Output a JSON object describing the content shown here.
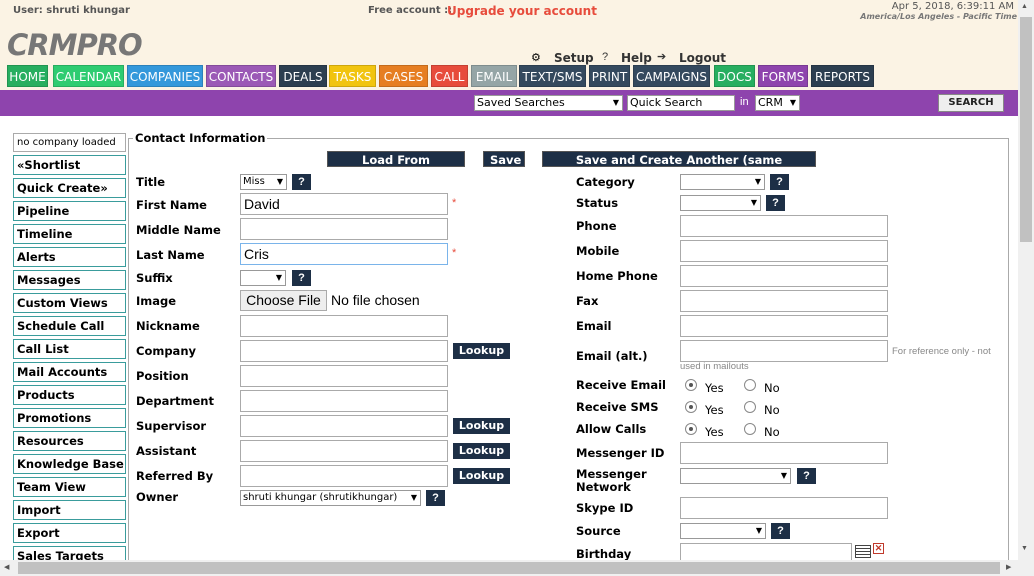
{
  "header": {
    "user_text": "User: shruti khungar",
    "free_account": "Free account ::",
    "upgrade_link": "Upgrade your account",
    "datetime": "Apr 5, 2018, 6:39:11 AM",
    "timezone": "America/Los Angeles - Pacific Time",
    "logo": "CRMPRO",
    "setup": "Setup",
    "help": "Help",
    "logout": "Logout"
  },
  "tabs": [
    {
      "label": "HOME",
      "color": "#27ae60"
    },
    {
      "label": "CALENDAR",
      "color": "#2ecc71"
    },
    {
      "label": "COMPANIES",
      "color": "#3498db"
    },
    {
      "label": "CONTACTS",
      "color": "#9b59b6"
    },
    {
      "label": "DEALS",
      "color": "#2c3e50"
    },
    {
      "label": "TASKS",
      "color": "#f1c40f"
    },
    {
      "label": "CASES",
      "color": "#e67e22"
    },
    {
      "label": "CALL",
      "color": "#e74c3c"
    },
    {
      "label": "EMAIL",
      "color": "#95a5a6"
    },
    {
      "label": "TEXT/SMS",
      "color": "#34495e"
    },
    {
      "label": "PRINT",
      "color": "#34495e"
    },
    {
      "label": "CAMPAIGNS",
      "color": "#34495e"
    },
    {
      "label": "DOCS",
      "color": "#27ae60"
    },
    {
      "label": "FORMS",
      "color": "#8e44ad"
    },
    {
      "label": "REPORTS",
      "color": "#2c3e50"
    }
  ],
  "searchbar": {
    "saved_searches": "Saved Searches",
    "quick_search_value": "Quick Search",
    "in_label": "in",
    "scope": "CRM",
    "search_button": "SEARCH"
  },
  "sidebar": {
    "company_loaded": "no company loaded",
    "items": [
      "«Shortlist",
      "Quick Create»",
      "Pipeline",
      "Timeline",
      "Alerts",
      "Messages",
      "Custom Views",
      "Schedule Call",
      "Call List",
      "Mail Accounts",
      "Products",
      "Promotions",
      "Resources",
      "Knowledge Base",
      "Team View",
      "Import",
      "Export",
      "Sales Targets"
    ]
  },
  "form": {
    "legend": "Contact Information",
    "buttons": {
      "load": "Load From Company",
      "save": "Save",
      "save_another": "Save and Create Another (same company)"
    },
    "lookup": "Lookup",
    "left": {
      "title_label": "Title",
      "title_value": "Miss",
      "first_name_label": "First Name",
      "first_name_value": "David",
      "middle_name_label": "Middle Name",
      "last_name_label": "Last Name",
      "last_name_value": "Cris",
      "suffix_label": "Suffix",
      "image_label": "Image",
      "choose_file": "Choose File",
      "no_file": "No file chosen",
      "nickname_label": "Nickname",
      "company_label": "Company",
      "position_label": "Position",
      "department_label": "Department",
      "supervisor_label": "Supervisor",
      "assistant_label": "Assistant",
      "referred_label": "Referred By",
      "owner_label": "Owner",
      "owner_value": "shruti khungar (shrutikhungar)"
    },
    "right": {
      "category_label": "Category",
      "status_label": "Status",
      "phone_label": "Phone",
      "mobile_label": "Mobile",
      "home_phone_label": "Home Phone",
      "fax_label": "Fax",
      "email_label": "Email",
      "email_alt_label": "Email (alt.)",
      "email_alt_note1": "For reference only - not",
      "email_alt_note2": "used in mailouts",
      "receive_email_label": "Receive Email",
      "receive_sms_label": "Receive SMS",
      "allow_calls_label": "Allow Calls",
      "yes": "Yes",
      "no": "No",
      "messenger_id_label": "Messenger ID",
      "messenger_network_label1": "Messenger",
      "messenger_network_label2": "Network",
      "skype_label": "Skype ID",
      "source_label": "Source",
      "birthday_label": "Birthday"
    }
  }
}
